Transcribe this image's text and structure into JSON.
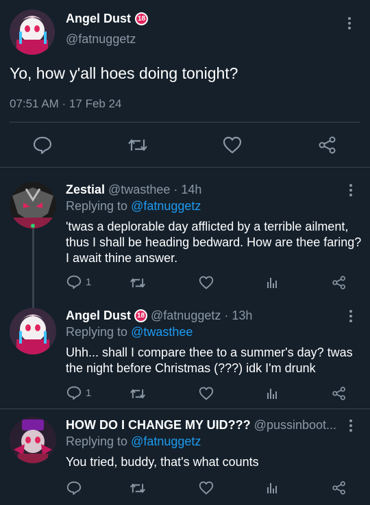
{
  "main_tweet": {
    "name": "Angel Dust",
    "badge": "18",
    "handle": "@fatnuggetz",
    "text": "Yo, how y'all hoes doing tonight?",
    "timestamp": "07:51 AM · 17 Feb 24"
  },
  "replies": [
    {
      "name": "Zestial",
      "handle": "@twasthee",
      "time": "· 14h",
      "replying_prefix": "Replying to",
      "replying_to": "@fatnuggetz",
      "text": "'twas a deplorable day afflicted by a terrible ailment, thus I shall be heading bedward. How are thee faring? I await thine answer.",
      "reply_count": "1"
    },
    {
      "name": "Angel Dust",
      "badge": "18",
      "handle": "@fatnuggetz",
      "time": "· 13h",
      "replying_prefix": "Replying to",
      "replying_to": "@twasthee",
      "text": "Uhh... shall I compare thee to a summer's day? twas the night before Christmas (???) idk I'm drunk",
      "reply_count": "1"
    },
    {
      "name": "HOW DO I CHANGE MY UID???",
      "handle": "@pussinboot...",
      "time": "",
      "replying_prefix": "Replying to",
      "replying_to": "@fatnuggetz",
      "text": "You tried, buddy, that's what counts",
      "reply_count": ""
    }
  ],
  "colors": {
    "background": "#15202b",
    "text": "#ffffff",
    "muted": "#8b98a5",
    "link": "#1d9bf0",
    "divider": "#38444d"
  },
  "icons": [
    "reply-icon",
    "retweet-icon",
    "like-icon",
    "share-icon",
    "analytics-icon",
    "more-icon"
  ]
}
